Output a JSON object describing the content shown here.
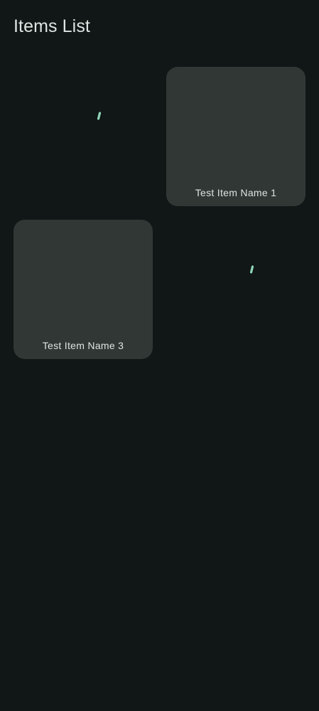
{
  "header": {
    "title": "Items List"
  },
  "items": [
    {
      "state": "loading",
      "label": ""
    },
    {
      "state": "loaded",
      "label": "Test Item Name 1"
    },
    {
      "state": "loaded",
      "label": "Test Item Name 3"
    },
    {
      "state": "loading",
      "label": ""
    }
  ],
  "colors": {
    "background": "#101716",
    "card": "#303735",
    "text": "#dde4e1",
    "spinner": "#8fd6b8"
  },
  "icons": {
    "loading": "progress-spinner-icon"
  }
}
